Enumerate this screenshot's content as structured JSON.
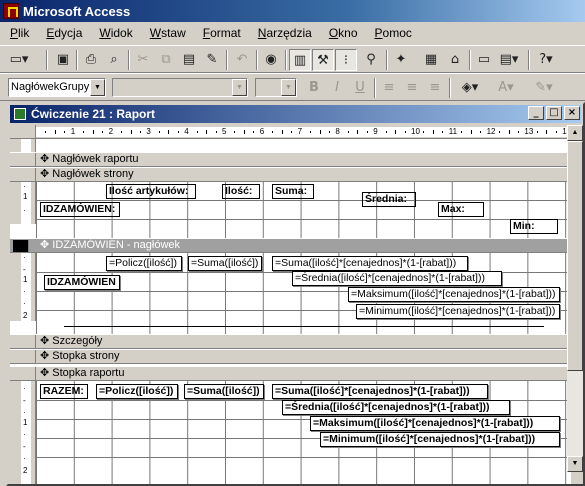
{
  "app": {
    "title": "Microsoft Access"
  },
  "menu": [
    "Plik",
    "Edycja",
    "Widok",
    "Wstaw",
    "Format",
    "Narzędzia",
    "Okno",
    "Pomoc"
  ],
  "toolbar": {
    "object_combo": "NagłówekGrupy",
    "font_combo": "",
    "size_combo": ""
  },
  "report_window": {
    "title": "Ćwiczenie 21 : Raport"
  },
  "ruler": {
    "marks": [
      "1",
      "2",
      "3",
      "4",
      "5",
      "6",
      "7",
      "8",
      "9",
      "10",
      "11",
      "12",
      "13",
      "14"
    ],
    "vmarks": [
      "1",
      "1",
      "1",
      "1"
    ]
  },
  "sections": {
    "report_header": "Nagłówek raportu",
    "page_header": "Nagłówek strony",
    "group_header": "IDZAMÓWIEN - nagłówek",
    "detail": "Szczegóły",
    "page_footer": "Stopka strony",
    "report_footer": "Stopka raportu"
  },
  "page_header_controls": {
    "items_label": "Ilość artykułów:",
    "qty_label": "Ilość:",
    "sum_label": "Suma:",
    "avg_label": "Średnia:",
    "order_label": "IDZAMÓWIEN:",
    "max_label": "Max:",
    "min_label": "Min:"
  },
  "group_header_controls": {
    "count": "=Policz([ilość])",
    "sum_qty": "=Suma([ilość])",
    "sum_value": "=Suma([ilość]*[cenajednos]*(1-[rabat]))",
    "avg_value": "=Średnia([ilość]*[cenajednos]*(1-[rabat]))",
    "max_value": "=Maksimum([ilość]*[cenajednos]*(1-[rabat]))",
    "min_value": "=Minimum([ilość]*[cenajednos]*(1-[rabat]))",
    "order_field": "IDZAMÓWIEN"
  },
  "report_footer_controls": {
    "total_label": "RAZEM:",
    "count": "=Policz([ilość])",
    "sum_qty": "=Suma([ilość])",
    "sum_value": "=Suma([ilość]*[cenajednos]*(1-[rabat]))",
    "avg_value": "=Średnia([ilość]*[cenajednos]*(1-[rabat]))",
    "max_value": "=Maksimum([ilość]*[cenajednos]*(1-[rabat]))",
    "min_value": "=Minimum([ilość]*[cenajednos]*(1-[rabat]))"
  },
  "icons": [
    "report-view-icon",
    "save-icon",
    "print-icon",
    "print-preview-icon",
    "cut-icon",
    "copy-icon",
    "paste-icon",
    "format-painter-icon",
    "undo-icon",
    "insert-hyperlink-icon",
    "field-list-icon",
    "toolbox-icon",
    "sorting-grouping-icon",
    "autoformat-icon",
    "code-icon",
    "properties-icon",
    "build-icon",
    "database-window-icon",
    "new-object-icon",
    "help-icon",
    "bold-icon",
    "italic-icon",
    "underline-icon",
    "align-left-icon",
    "align-center-icon",
    "align-right-icon",
    "fill-color-icon",
    "font-color-icon",
    "line-color-icon"
  ]
}
